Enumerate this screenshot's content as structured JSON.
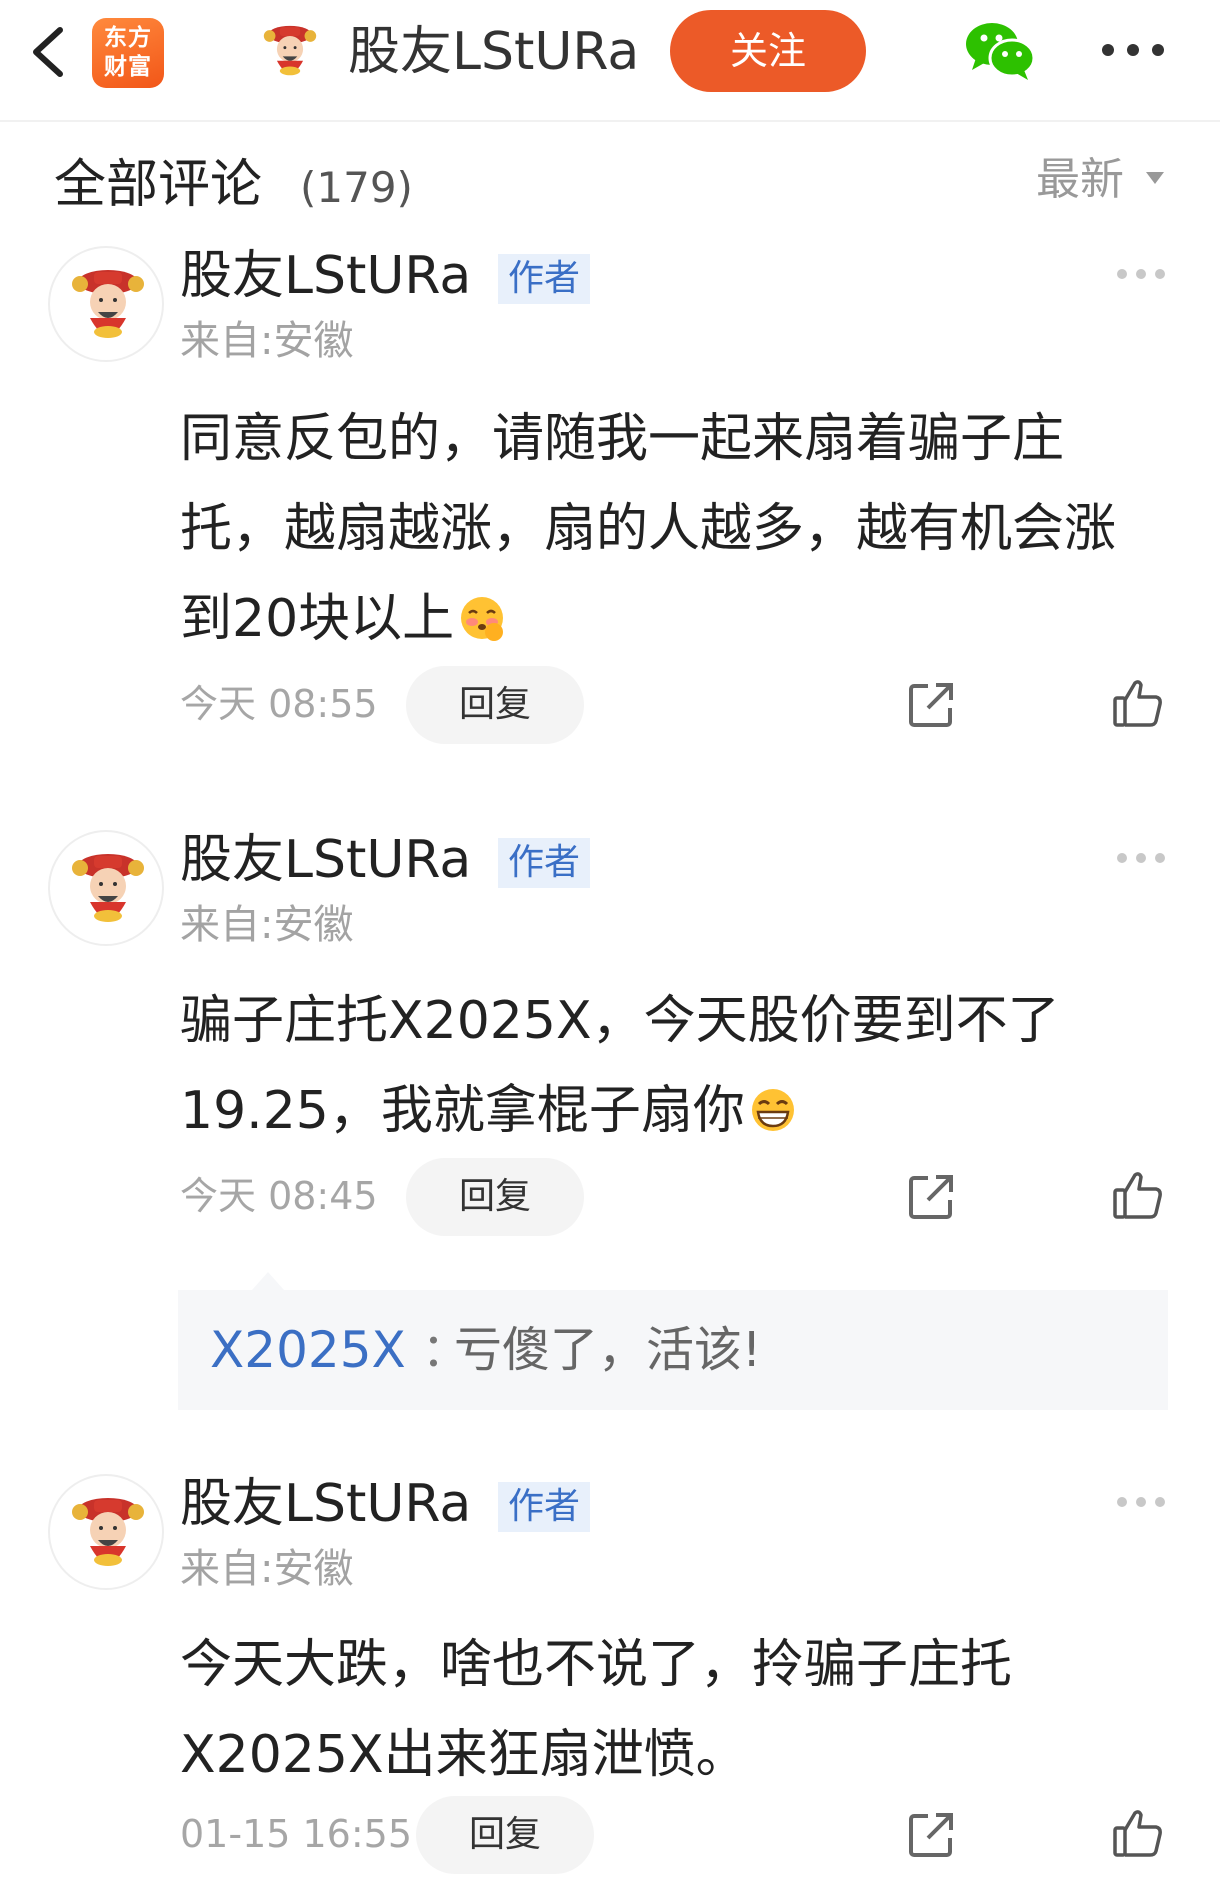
{
  "header": {
    "back_icon": "chevron-left-icon",
    "app_logo_text": "东方财富",
    "title": "股友LStURa",
    "follow_label": "关注",
    "share_icon": "wechat-icon",
    "more_icon": "more-dots-icon",
    "accent_color": "#ec5a28"
  },
  "comments_header": {
    "title": "全部评论",
    "count": "(179)",
    "sort_label": "最新"
  },
  "comments": [
    {
      "author": "股友LStURa",
      "badge": "作者",
      "location": "来自:安徽",
      "lines": [
        "同意反包的，请随我一起来扇着骗子庄",
        "托，越扇越涨，扇的人越多，越有机会涨",
        "到20块以上"
      ],
      "emoji": "blushing-emoji",
      "time": "今天 08:55",
      "reply_label": "回复"
    },
    {
      "author": "股友LStURa",
      "badge": "作者",
      "location": "来自:安徽",
      "lines": [
        "骗子庄托X2025X，今天股价要到不了",
        "19.25，我就拿棍子扇你"
      ],
      "emoji": "grinning-emoji",
      "time": "今天 08:45",
      "reply_label": "回复",
      "sub_reply": {
        "user": "X2025X",
        "separator": "：",
        "text": "亏傻了，活该!"
      }
    },
    {
      "author": "股友LStURa",
      "badge": "作者",
      "location": "来自:安徽",
      "lines": [
        "今天大跌，啥也不说了，拎骗子庄托",
        "X2025X出来狂扇泄愤。"
      ],
      "time": "01-15 16:55",
      "reply_label": "回复"
    }
  ]
}
